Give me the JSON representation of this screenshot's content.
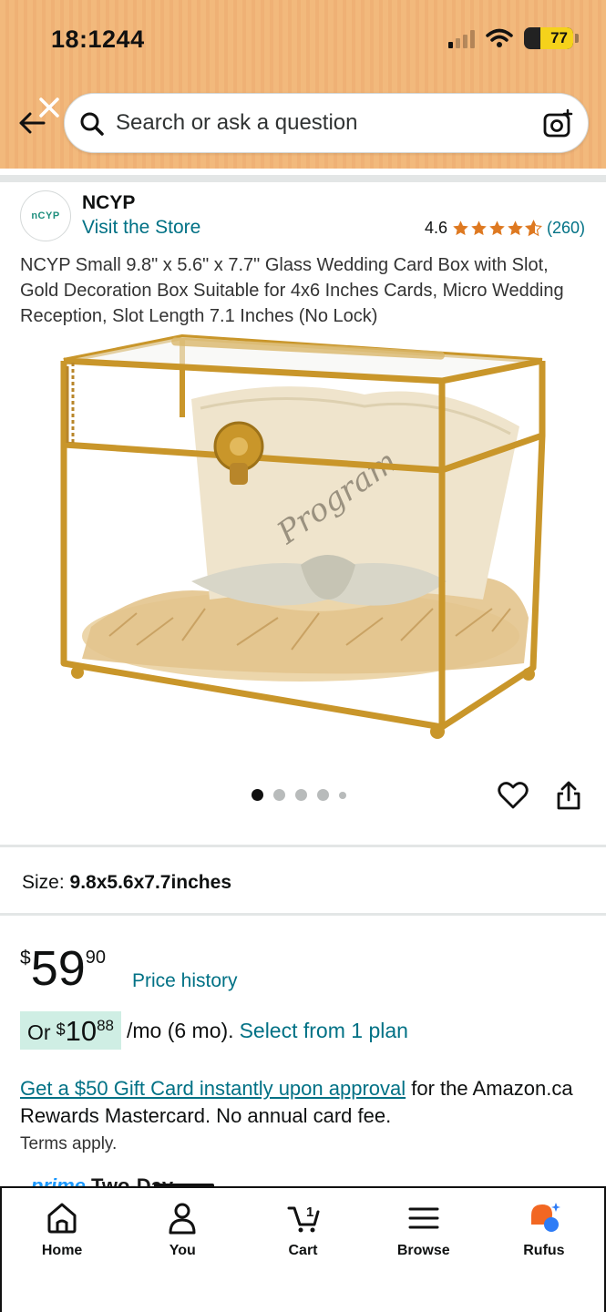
{
  "status_bar": {
    "time": "18:\u0000244",
    "time_display": "18:1244",
    "battery": "77"
  },
  "search": {
    "placeholder": "Search or ask a question"
  },
  "store": {
    "logo_text": "nCYP",
    "name": "NCYP",
    "visit_label": "Visit the Store",
    "rating": "4.6",
    "review_count": "(260)"
  },
  "product": {
    "title": "NCYP Small 9.8\" x 5.6\" x 7.7\" Glass Wedding Card Box with Slot, Gold Decoration Box Suitable for 4x6 Inches Cards, Micro Wedding Reception, Slot Length 7.1 Inches (No Lock)",
    "image_count": 5,
    "active_image": 1,
    "size_label": "Size:",
    "size_value": "9.8x5.6x7.7inches"
  },
  "price": {
    "symbol": "$",
    "whole": "59",
    "fraction": "90",
    "history_label": "Price history"
  },
  "monthly": {
    "or_label": "Or",
    "symbol": "$",
    "whole": "10",
    "fraction": "88",
    "term": "/mo (6 mo).",
    "link": "Select from 1 plan"
  },
  "rewards": {
    "link": "Get a $50 Gift Card instantly upon approval",
    "text": " for the Amazon.ca Rewards Mastercard. No annual card fee.",
    "terms": "Terms apply."
  },
  "prime_peek": {
    "prime": "prime",
    "text": " Two-Day"
  },
  "bottom_nav": {
    "items": [
      {
        "label": "Home",
        "icon": "home-icon"
      },
      {
        "label": "You",
        "icon": "user-icon"
      },
      {
        "label": "Cart",
        "icon": "cart-icon",
        "count": "1"
      },
      {
        "label": "Browse",
        "icon": "menu-icon"
      },
      {
        "label": "Rufus",
        "icon": "rufus-icon"
      }
    ]
  },
  "colors": {
    "header": "#f2b97c",
    "link": "#007185",
    "star": "#de7921",
    "monthly_badge": "#cfeee4",
    "gold": "#c9962a"
  }
}
